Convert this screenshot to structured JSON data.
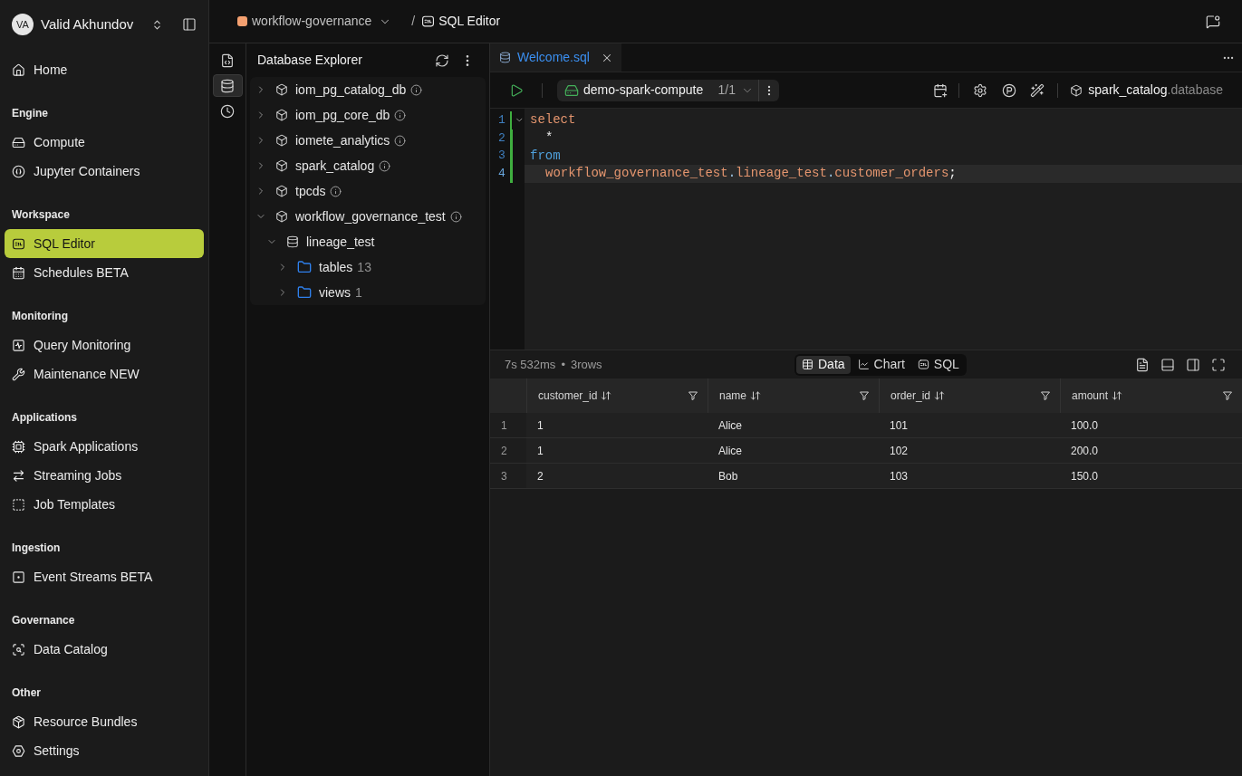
{
  "user": {
    "initials": "VA",
    "name": "Valid Akhundov"
  },
  "sidebar": {
    "sections": [
      {
        "items": [
          {
            "label": "Home",
            "selected": false
          }
        ]
      },
      {
        "title": "Engine",
        "items": [
          {
            "label": "Compute",
            "selected": false
          },
          {
            "label": "Jupyter Containers",
            "selected": false
          }
        ]
      },
      {
        "title": "Workspace",
        "items": [
          {
            "label": "SQL Editor",
            "selected": true
          },
          {
            "label": "Schedules BETA",
            "selected": false
          }
        ]
      },
      {
        "title": "Monitoring",
        "items": [
          {
            "label": "Query Monitoring",
            "selected": false
          },
          {
            "label": "Maintenance NEW",
            "selected": false
          }
        ]
      },
      {
        "title": "Applications",
        "items": [
          {
            "label": "Spark Applications",
            "selected": false
          },
          {
            "label": "Streaming Jobs",
            "selected": false
          },
          {
            "label": "Job Templates",
            "selected": false
          }
        ]
      },
      {
        "title": "Ingestion",
        "items": [
          {
            "label": "Event Streams BETA",
            "selected": false
          }
        ]
      },
      {
        "title": "Governance",
        "items": [
          {
            "label": "Data Catalog",
            "selected": false
          }
        ]
      },
      {
        "title": "Other",
        "items": [
          {
            "label": "Resource Bundles",
            "selected": false
          },
          {
            "label": "Settings",
            "selected": false
          }
        ]
      }
    ]
  },
  "breadcrumb": {
    "workspace": "workflow-governance",
    "separator": "/",
    "page": "SQL Editor"
  },
  "tool_rail": [
    {
      "selected": false
    },
    {
      "selected": true
    },
    {
      "selected": false
    }
  ],
  "explorer": {
    "title": "Database Explorer",
    "tree": [
      {
        "label": "iom_pg_catalog_db",
        "kind": "catalog",
        "expanded": false
      },
      {
        "label": "iom_pg_core_db",
        "kind": "catalog",
        "expanded": false
      },
      {
        "label": "iomete_analytics",
        "kind": "catalog",
        "expanded": false
      },
      {
        "label": "spark_catalog",
        "kind": "catalog",
        "expanded": false
      },
      {
        "label": "tpcds",
        "kind": "catalog",
        "expanded": false
      },
      {
        "label": "workflow_governance_test",
        "kind": "catalog",
        "expanded": true,
        "children": [
          {
            "label": "lineage_test",
            "kind": "database",
            "expanded": true,
            "children": [
              {
                "label": "tables",
                "count": "13",
                "kind": "folder",
                "expanded": false
              },
              {
                "label": "views",
                "count": "1",
                "kind": "folder",
                "expanded": false
              }
            ]
          }
        ]
      }
    ]
  },
  "editor": {
    "tabs": [
      {
        "label": "Welcome.sql",
        "selected": true
      }
    ],
    "toolbar": {
      "compute": "demo-spark-compute",
      "compute_count": "1/1",
      "catalog": "spark_catalog",
      "database_placeholder": ".database"
    },
    "lines": [
      {
        "number": "1",
        "indented": false,
        "foldable": true,
        "modified": true,
        "active": false,
        "tokens": [
          {
            "text": "select",
            "kind": "keyword"
          }
        ]
      },
      {
        "number": "2",
        "indented": true,
        "foldable": false,
        "modified": true,
        "active": false,
        "tokens": [
          {
            "text": "*",
            "kind": "operator"
          }
        ]
      },
      {
        "number": "3",
        "indented": false,
        "foldable": false,
        "modified": true,
        "active": false,
        "tokens": [
          {
            "text": "from",
            "kind": "builtin"
          }
        ]
      },
      {
        "number": "4",
        "indented": true,
        "foldable": false,
        "modified": true,
        "active": true,
        "tokens": [
          {
            "text": "workflow_governance_test",
            "kind": "identifier"
          },
          {
            "text": ".",
            "kind": "accessor"
          },
          {
            "text": "lineage_test",
            "kind": "identifier"
          },
          {
            "text": ".",
            "kind": "accessor"
          },
          {
            "text": "customer_orders",
            "kind": "identifier"
          },
          {
            "text": ";",
            "kind": "punctuation"
          }
        ]
      }
    ]
  },
  "results": {
    "duration": "7s 532ms",
    "separator": "•",
    "row_count": "3rows",
    "views": [
      {
        "label": "Data",
        "selected": true
      },
      {
        "label": "Chart",
        "selected": false
      },
      {
        "label": "SQL",
        "selected": false
      }
    ],
    "table": {
      "columns": [
        "customer_id",
        "name",
        "order_id",
        "amount"
      ],
      "rows": [
        {
          "index": "1",
          "cells": [
            "1",
            "Alice",
            "101",
            "100.0"
          ]
        },
        {
          "index": "2",
          "cells": [
            "1",
            "Alice",
            "102",
            "200.0"
          ]
        },
        {
          "index": "3",
          "cells": [
            "2",
            "Bob",
            "103",
            "150.0"
          ]
        }
      ]
    }
  }
}
